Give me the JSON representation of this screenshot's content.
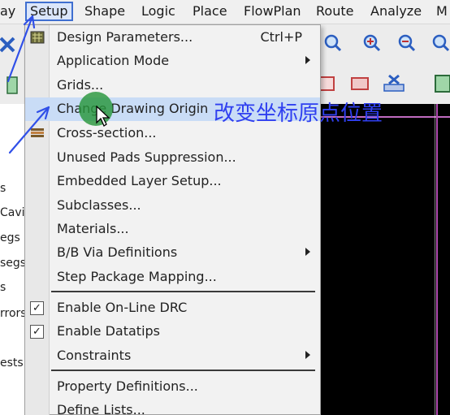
{
  "menubar": {
    "items": [
      "ay",
      "Setup",
      "Shape",
      "Logic",
      "Place",
      "FlowPlan",
      "Route",
      "Analyze",
      "M"
    ],
    "active": "Setup"
  },
  "left_panel": {
    "items": [
      "s",
      "Cavi",
      "egs",
      "segs",
      "s",
      "rrors",
      "ests"
    ]
  },
  "setup_menu": {
    "items": [
      {
        "label": "Design Parameters...",
        "shortcut": "Ctrl+P"
      },
      {
        "label": "Application Mode",
        "submenu": true
      },
      {
        "label": "Grids..."
      },
      {
        "label": "Change Drawing Origin",
        "highlighted": true
      },
      {
        "label": "Cross-section..."
      },
      {
        "label": "Unused Pads Suppression..."
      },
      {
        "label": "Embedded Layer Setup..."
      },
      {
        "label": "Subclasses..."
      },
      {
        "label": "Materials..."
      },
      {
        "label": "B/B Via Definitions",
        "submenu": true
      },
      {
        "label": "Step Package Mapping..."
      },
      {
        "label": "Enable On-Line DRC",
        "checked": true
      },
      {
        "label": "Enable Datatips",
        "checked": true
      },
      {
        "label": "Constraints",
        "submenu": true
      },
      {
        "label": "Property Definitions..."
      },
      {
        "label": "Define Lists..."
      }
    ]
  },
  "annotation_text": "改变坐标原点位置",
  "colors": {
    "annotation": "#2f3ff0",
    "highlight": "#c9dcf6",
    "canvas": "#000000",
    "cursor_circle": "#2a9a3c",
    "accent_line": "#b04bb0"
  },
  "icons": {
    "toolbar": [
      "close-icon",
      "zoom-icon",
      "zoom-in-icon",
      "zoom-out-icon",
      "zoom-fit-icon",
      "rect-icon",
      "shape-icon",
      "delete-icon",
      "layers-icon"
    ]
  }
}
